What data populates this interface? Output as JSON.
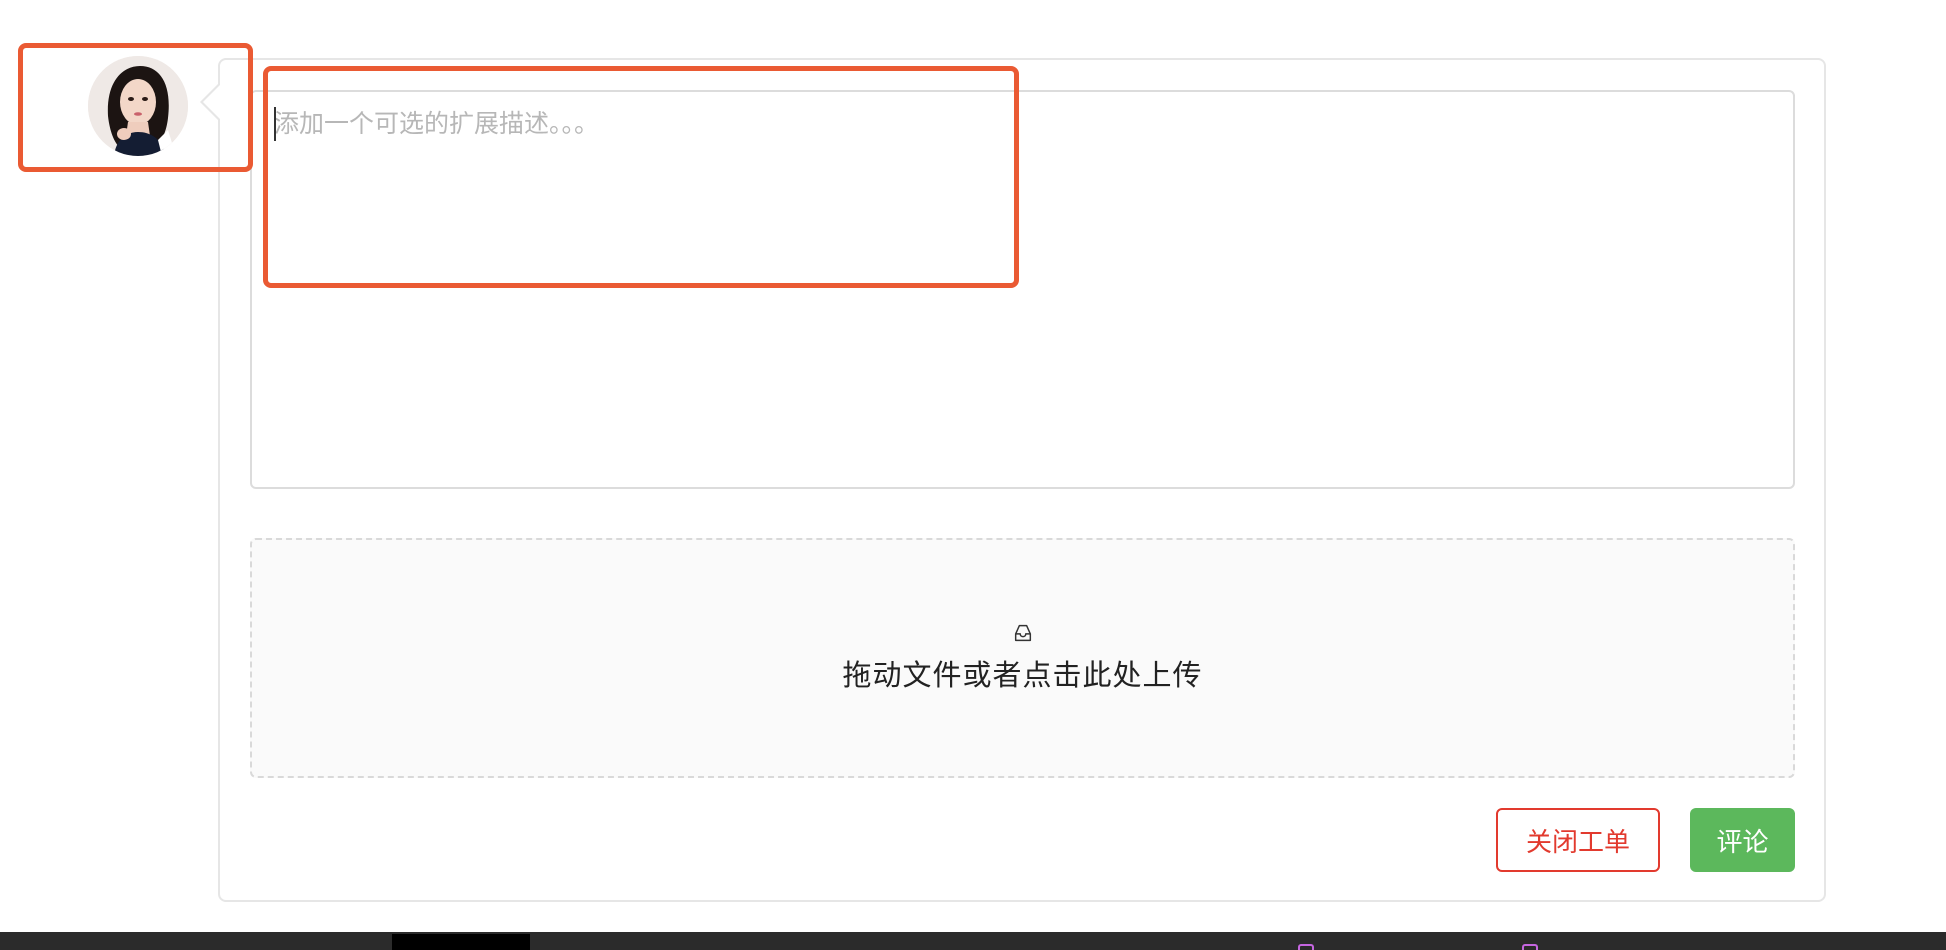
{
  "comment": {
    "avatar_icon": "user-avatar-photo",
    "textarea": {
      "placeholder": "添加一个可选的扩展描述。。。",
      "value": ""
    },
    "upload": {
      "icon": "inbox-icon",
      "text": "拖动文件或者点击此处上传"
    },
    "buttons": {
      "close_ticket": "关闭工单",
      "comment": "评论"
    }
  },
  "colors": {
    "annotation": "#ea5a33",
    "close_button": "#e23a2e",
    "comment_button": "#5cb85c",
    "taskbar": "#2b2b2b"
  }
}
